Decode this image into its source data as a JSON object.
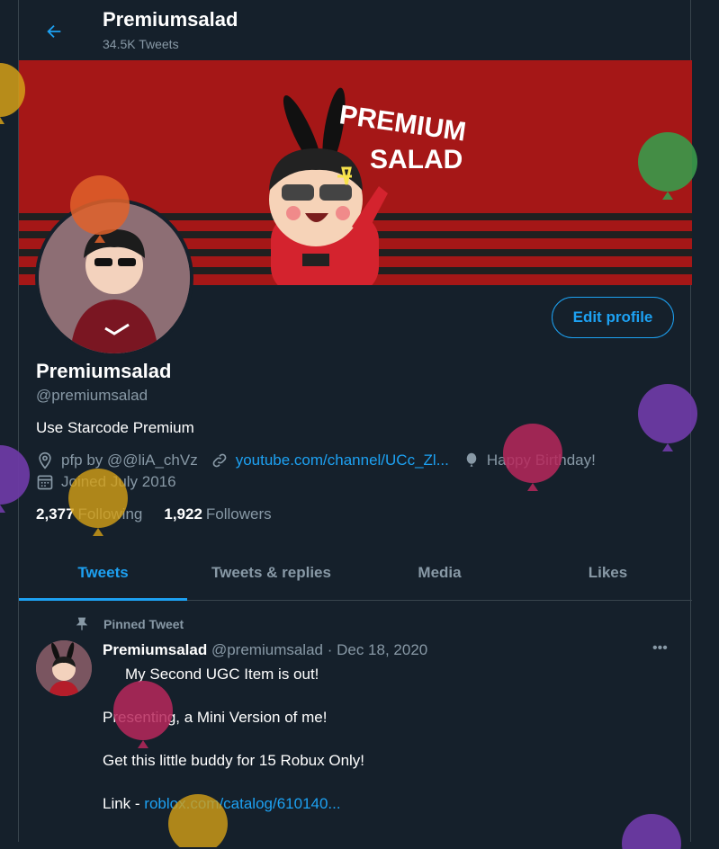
{
  "header": {
    "title": "Premiumsalad",
    "tweet_count": "34.5K Tweets"
  },
  "banner": {
    "text_line1": "PREMIUM",
    "text_line2": "SALAD"
  },
  "profile": {
    "edit_label": "Edit profile",
    "name": "Premiumsalad",
    "handle": "@premiumsalad",
    "bio": "Use Starcode Premium",
    "location": "pfp by @@liA_chVz",
    "website": "youtube.com/channel/UCc_Zl...",
    "birthday": "Happy Birthday!",
    "joined": "Joined July 2016",
    "following_count": "2,377",
    "following_label": "Following",
    "followers_count": "1,922",
    "followers_label": "Followers"
  },
  "tabs": [
    {
      "label": "Tweets"
    },
    {
      "label": "Tweets & replies"
    },
    {
      "label": "Media"
    },
    {
      "label": "Likes"
    }
  ],
  "tweet": {
    "pinned_label": "Pinned Tweet",
    "author": "Premiumsalad",
    "meta": "@premiumsalad · Dec 18, 2020",
    "more": "•••",
    "line1": "My Second UGC Item is out!",
    "line2": "Presenting, a Mini Version of me!",
    "line3": "Get this little buddy for 15 Robux Only!",
    "link_prefix": "Link - ",
    "link": "roblox.com/catalog/610140..."
  },
  "colors": {
    "accent": "#1da1f2",
    "background": "#15202b",
    "banner": "#a51717"
  }
}
